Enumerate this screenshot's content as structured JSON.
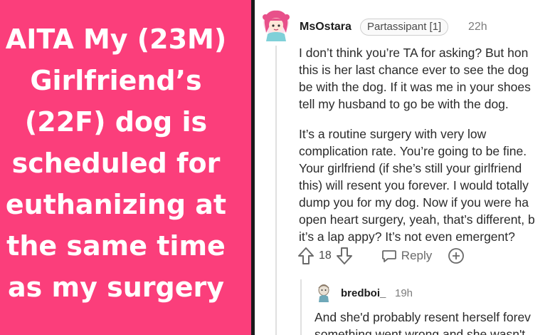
{
  "post": {
    "title_lines": [
      "AITA My (23M)",
      "Girlfriend’s",
      "(22F) dog is",
      "scheduled for",
      "euthanizing at",
      "the same time",
      "as my surgery"
    ]
  },
  "comment": {
    "username": "MsOstara",
    "flair": "Partassipant [1]",
    "time": "22h",
    "paragraphs": [
      [
        "I don’t think you’re TA for asking? But hon",
        "this is her last chance ever to see the dog",
        "be with the dog. If it was me in your shoes",
        "tell my husband to go be with the dog."
      ],
      [
        "It’s a routine surgery with very low",
        "complication rate. You’re going to be fine.",
        "Your girlfriend (if she’s still your girlfriend",
        "this) will resent you forever. I would totally",
        "dump you for my dog. Now if you were ha",
        "open heart surgery, yeah, that’s different, b",
        "it’s a lap appy? It’s not even emergent?"
      ]
    ],
    "vote_count": "18",
    "reply_label": "Reply"
  },
  "reply": {
    "username": "bredboi_",
    "time": "19h",
    "lines": [
      "And she'd probably resent herself forev",
      "something went wrong and she wasn't"
    ]
  },
  "colors": {
    "left_panel": "#fb3e7b",
    "divider": "#1a1a1b",
    "background": "#ffffff"
  },
  "icons": {
    "avatar": "anime-girl-avatar",
    "upvote": "arrow-up-icon",
    "downvote": "arrow-down-icon",
    "reply": "speech-bubble-icon",
    "award": "plus-circle-icon"
  }
}
